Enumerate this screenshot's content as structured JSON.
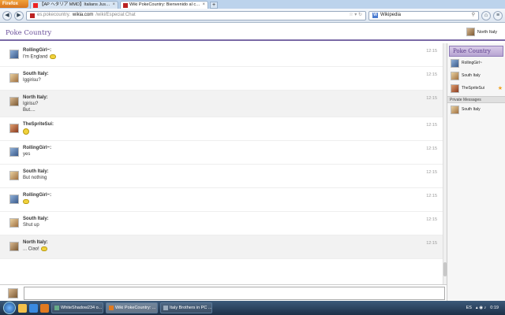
{
  "browser": {
    "firefox_label": "Firefox",
    "tabs": [
      {
        "label": "【AP ヘタリア MMD】Italians Just be Frie...",
        "active": false
      },
      {
        "label": "Wiki PokeCountry: Bienvenido al chat...",
        "active": true
      },
      {
        "label": "",
        "active": false
      }
    ],
    "new_tab": "+",
    "url_prefix": "es.pokecountry.",
    "url_domain": "wikia.com",
    "url_path": "/wiki/Especial:Chat",
    "search_engine": "Wikipedia"
  },
  "chat": {
    "logo": "Poke Country",
    "current_user": "North Italy",
    "messages": [
      {
        "user": "RollingGirl~:",
        "lines": [
          "I'm England"
        ],
        "time": "12:15",
        "emoji": "after"
      },
      {
        "user": "South Italy:",
        "lines": [
          "Iggirisu?"
        ],
        "time": "12:15",
        "emoji": ""
      },
      {
        "user": "North Italy:",
        "lines": [
          "Igirisu?",
          "But...."
        ],
        "time": "12:15",
        "emoji": ""
      },
      {
        "user": "TheSpriteSui:",
        "lines": [],
        "time": "12:15",
        "emoji": "only"
      },
      {
        "user": "RollingGirl~:",
        "lines": [
          "yes"
        ],
        "time": "12:15",
        "emoji": ""
      },
      {
        "user": "South Italy:",
        "lines": [
          "But nothing"
        ],
        "time": "12:15",
        "emoji": ""
      },
      {
        "user": "RollingGirl~:",
        "lines": [],
        "time": "12:15",
        "emoji": "only"
      },
      {
        "user": "South Italy:",
        "lines": [
          "Shut up"
        ],
        "time": "12:15",
        "emoji": ""
      },
      {
        "user": "North Italy:",
        "lines": [
          "... Ciao!"
        ],
        "time": "12:15",
        "emoji": "after"
      }
    ],
    "sidebar": {
      "title": "Poke Country",
      "users": [
        "RollingGirl~",
        "South Italy",
        "TheSpriteSui"
      ],
      "private_label": "Private Messages",
      "private_users": [
        "South Italy"
      ]
    }
  },
  "taskbar": {
    "tasks": [
      {
        "label": "WhiteShadow234 o...",
        "active": false
      },
      {
        "label": "Wiki PokeCountry: ...",
        "active": true
      },
      {
        "label": "Italy Brothers in PC ...",
        "active": false
      }
    ],
    "lang": "ES",
    "clock": "0:19"
  },
  "colors": {
    "accent": "#7a6aa6",
    "logo": "#6a4f9a",
    "star": "#f0a020"
  }
}
